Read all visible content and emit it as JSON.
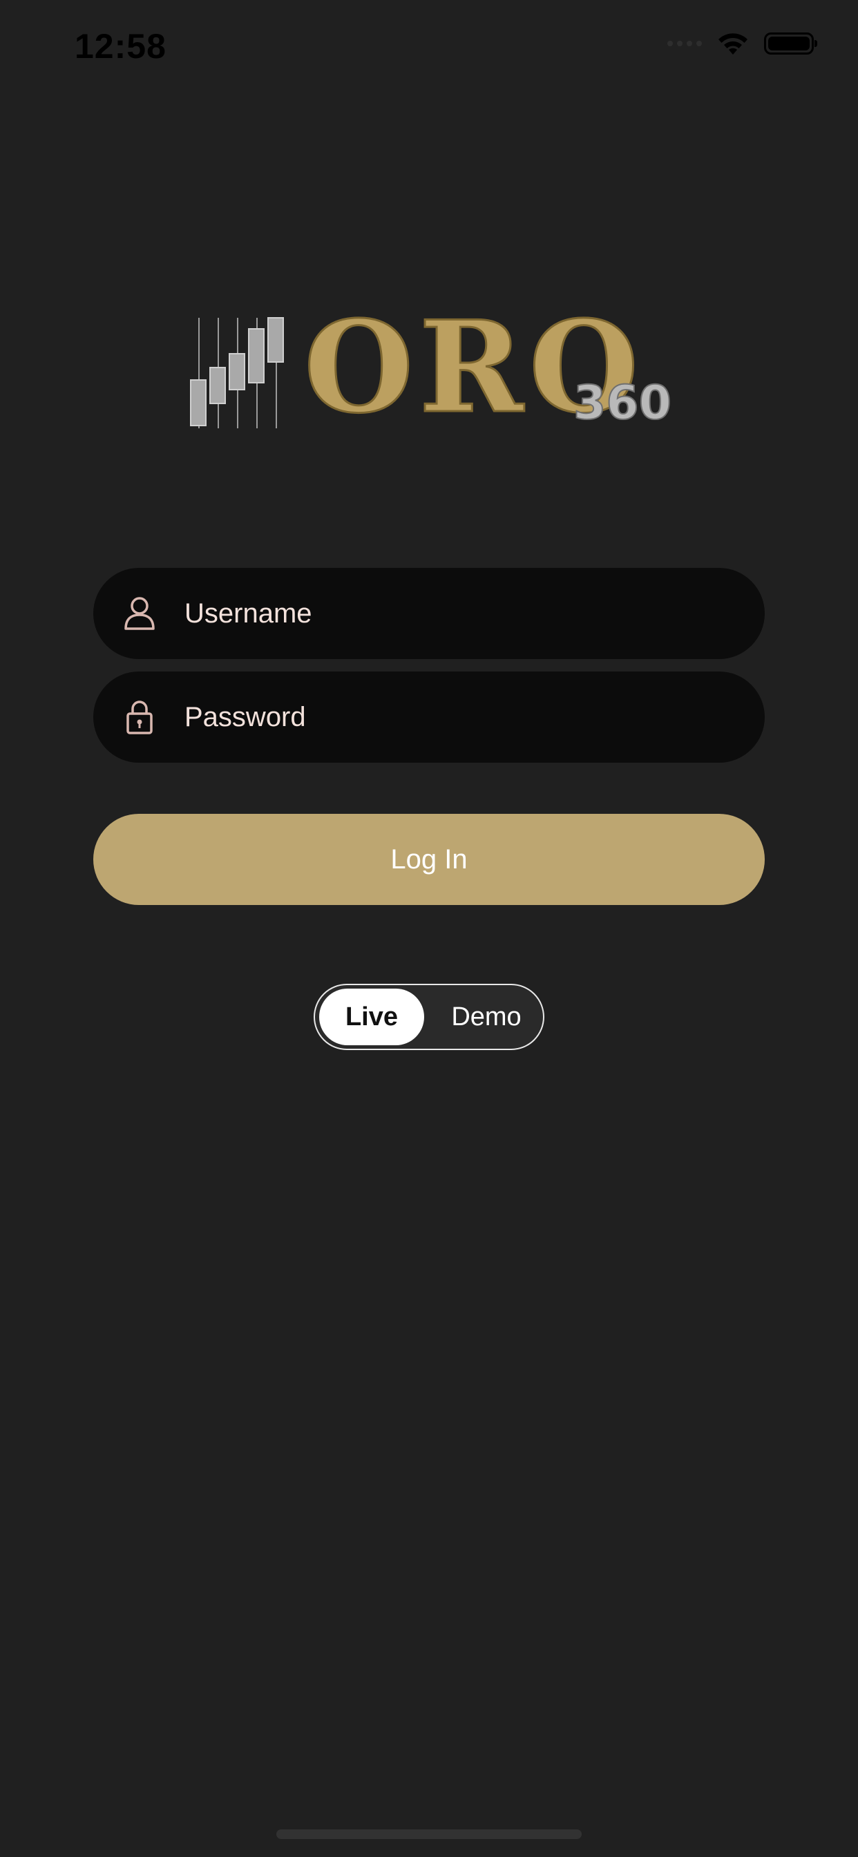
{
  "status_bar": {
    "time": "12:58"
  },
  "logo": {
    "main_text": "ORO",
    "sub_text": "360",
    "gold_color": "#bca060",
    "silver_color": "#b9b9b9"
  },
  "form": {
    "username_placeholder": "Username",
    "password_placeholder": "Password",
    "login_label": "Log In"
  },
  "mode_toggle": {
    "options": [
      "Live",
      "Demo"
    ],
    "selected": "Live"
  },
  "colors": {
    "background": "#202020",
    "field_background": "#0c0c0c",
    "accent": "#bda671",
    "placeholder_text": "#f3e2dc"
  },
  "icons": {
    "username": "user-icon",
    "password": "lock-icon",
    "wifi": "wifi-icon",
    "battery": "battery-icon"
  }
}
